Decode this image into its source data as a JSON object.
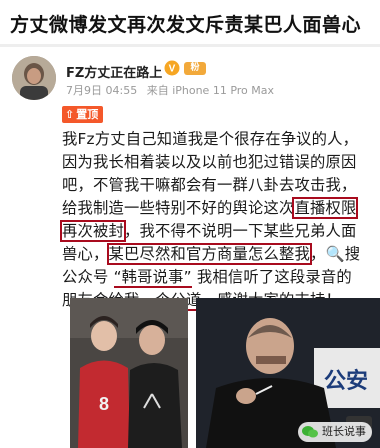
{
  "headline": "方丈微博发文再次发文斥责某巴人面兽心",
  "post": {
    "author": "FZ方丈正在路上",
    "badge": "V",
    "fan_badge": "粉",
    "date": "7月9日 04:55",
    "via": "来自 iPhone 11 Pro Max",
    "pinned_label": "置顶",
    "lines": [
      {
        "text": "我Fz方丈自己知道我是个很存在争议的人，"
      },
      {
        "text": "因为我长相着装以及以前也犯过错误的原因"
      },
      {
        "text": "吧，不管我干嘛都会有一群八卦去攻击我，"
      },
      {
        "pre": "给我制造一些特别不好的舆论这次",
        "hl": "直播权限"
      },
      {
        "hl": "再次被封",
        "post": "，我不得不说明一下某些兄弟人面"
      },
      {
        "pre": "兽心，",
        "hl": "某巴尽然和官方商量怎么整我",
        "post": "，"
      },
      {
        "text": "公众号 ",
        "tag": "“韩哥说事”",
        "post": " 我相信听了这段录音的"
      },
      {
        "pre": "朋友会给我一个",
        "ul": "公道",
        "post": "，感谢大家的支持！"
      }
    ],
    "search_suffix": "搜"
  },
  "photos": {
    "left_jersey_number": "8",
    "right_sign_text": "公安"
  },
  "watermark": "班长说事",
  "colors": {
    "highlight": "#a80b1e",
    "pin_badge": "#f4582a",
    "meta_gray": "#9a9a9a"
  }
}
